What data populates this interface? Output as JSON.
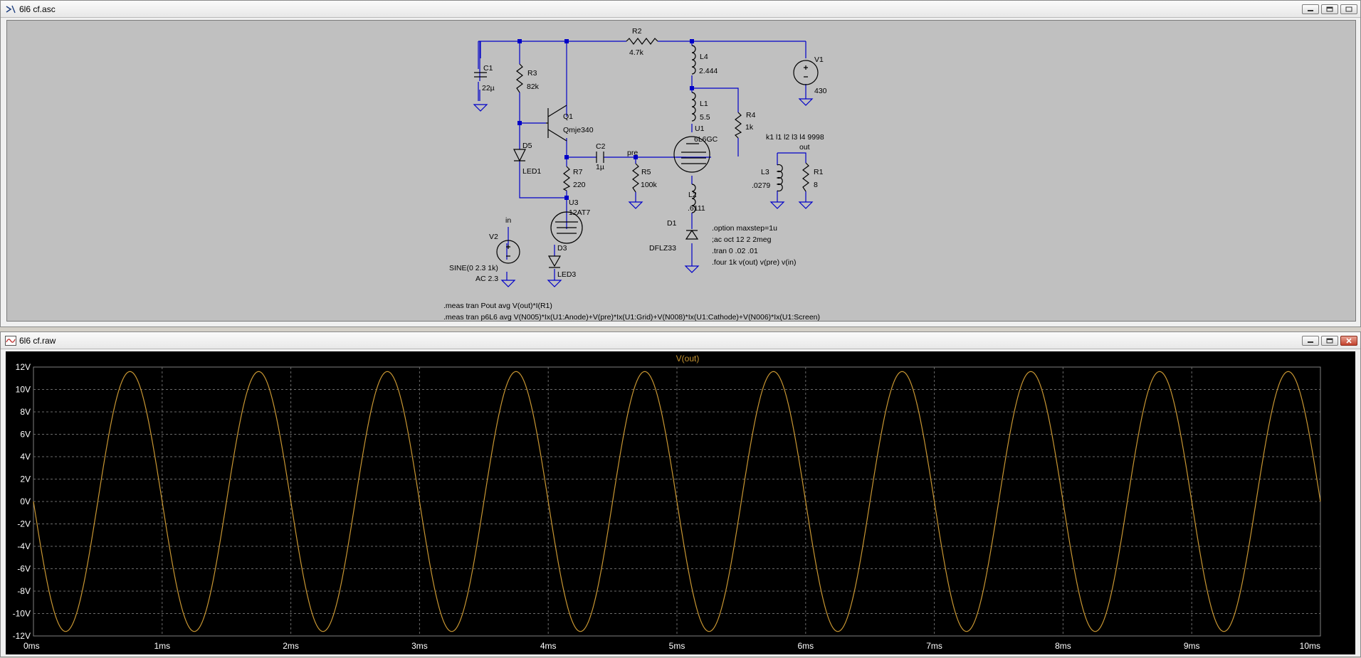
{
  "schematic_window": {
    "title": "6l6 cf.asc",
    "labels": {
      "R2": "R2",
      "R2_val": "4.7k",
      "C1": "C1",
      "C1_val": "22µ",
      "R3": "R3",
      "R3_val": "82k",
      "Q1": "Q1",
      "Q1_val": "Qmje340",
      "D5": "D5",
      "D5_val": "LED1",
      "C2": "C2",
      "C2_val": "1µ",
      "pre": "pre",
      "R7": "R7",
      "R7_val": "220",
      "R5": "R5",
      "R5_val": "100k",
      "U3": "U3",
      "U3_val": "12AT7",
      "in": "in",
      "V2": "V2",
      "V2_val1": "SINE(0 2.3 1k)",
      "V2_val2": "AC 2.3",
      "D3": "D3",
      "D3_val": "LED3",
      "L4": "L4",
      "L4_val": "2.444",
      "L1": "L1",
      "L1_val": "5.5",
      "U1": "U1",
      "U1_val": "6L6GC",
      "R4": "R4",
      "R4_val": "1k",
      "L2": "L2",
      "L2_val": ".6111",
      "D1": "D1",
      "D1_val": "DFLZ33",
      "V1": "V1",
      "V1_val": "430",
      "k1": "k1 l1 l2 l3 l4 9998",
      "out": "out",
      "L3": "L3",
      "L3_val": ".0279",
      "R1": "R1",
      "R1_val": "8"
    },
    "directives": [
      ".option maxstep=1u",
      ";ac oct 12 2 2meg",
      ".tran 0 .02 .01",
      ".four 1k v(out) v(pre) v(in)"
    ],
    "meas": [
      ".meas tran Pout avg V(out)*I(R1)",
      ".meas tran p6L6 avg V(N005)*Ix(U1:Anode)+V(pre)*Ix(U1:Grid)+V(N008)*Ix(U1:Cathode)+V(N006)*Ix(U1:Screen)"
    ]
  },
  "waveform_window": {
    "title": "6l6 cf.raw",
    "trace_color": "#c89632"
  },
  "chart_data": {
    "type": "line",
    "title": "V(out)",
    "xlabel": "",
    "ylabel": "",
    "x_unit": "ms",
    "xlim": [
      0,
      10
    ],
    "ylim": [
      -12,
      12
    ],
    "grid": true,
    "x_ticks": [
      "0ms",
      "1ms",
      "2ms",
      "3ms",
      "4ms",
      "5ms",
      "6ms",
      "7ms",
      "8ms",
      "9ms",
      "10ms"
    ],
    "y_ticks": [
      "12V",
      "10V",
      "8V",
      "6V",
      "4V",
      "2V",
      "0V",
      "-2V",
      "-4V",
      "-6V",
      "-8V",
      "-10V",
      "-12V"
    ],
    "series": [
      {
        "name": "V(out)",
        "frequency_khz": 1,
        "amplitude_v": 11.6,
        "offset_v": 0,
        "x": [
          0,
          0.25,
          0.5,
          0.75,
          1.0,
          1.25,
          1.5,
          1.75,
          2.0,
          2.25,
          2.5,
          2.75,
          3.0,
          3.25,
          3.5,
          3.75,
          4.0,
          4.25,
          4.5,
          4.75,
          5.0,
          5.25,
          5.5,
          5.75,
          6.0,
          6.25,
          6.5,
          6.75,
          7.0,
          7.25,
          7.5,
          7.75,
          8.0,
          8.25,
          8.5,
          8.75,
          9.0,
          9.25,
          9.5,
          9.75,
          10.0
        ],
        "y": [
          0,
          -11.6,
          0,
          11.6,
          0,
          -11.6,
          0,
          11.6,
          0,
          -11.6,
          0,
          11.6,
          0,
          -11.6,
          0,
          11.6,
          0,
          -11.6,
          0,
          11.6,
          0,
          -11.6,
          0,
          11.6,
          0,
          -11.6,
          0,
          11.6,
          0,
          -11.6,
          0,
          11.6,
          0,
          -11.6,
          0,
          11.6,
          0,
          -11.6,
          0,
          11.6,
          0
        ]
      }
    ]
  }
}
